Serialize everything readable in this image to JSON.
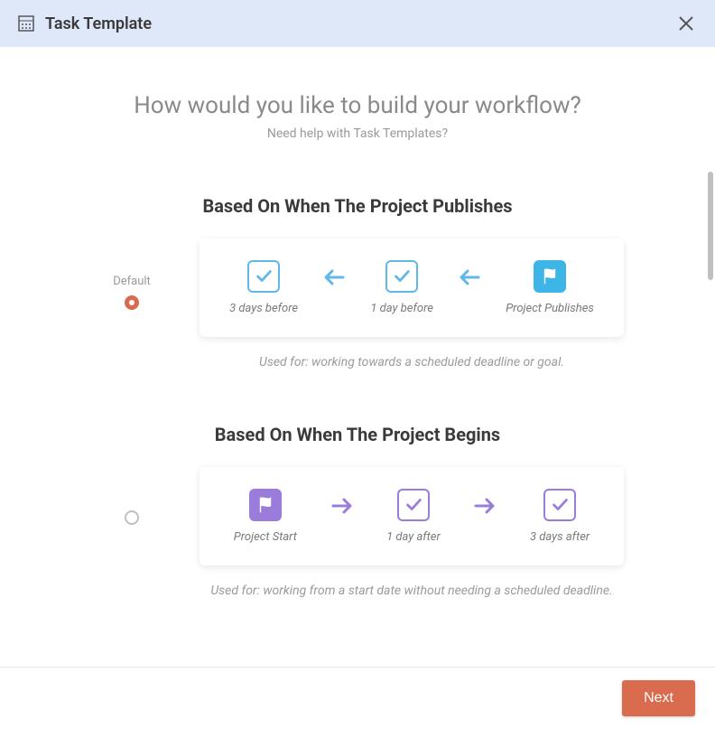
{
  "header": {
    "title": "Task Template"
  },
  "heading": "How would you like to build your workflow?",
  "help_text": "Need help with Task Templates?",
  "options": {
    "publishes": {
      "title": "Based On When The Project Publishes",
      "radio_label": "Default",
      "selected": true,
      "steps": [
        "3 days before",
        "1 day before",
        "Project Publishes"
      ],
      "caption": "Used for: working towards a scheduled deadline or goal."
    },
    "begins": {
      "title": "Based On When The Project Begins",
      "selected": false,
      "steps": [
        "Project Start",
        "1 day after",
        "3 days after"
      ],
      "caption": "Used for: working from a start date without needing a scheduled deadline."
    }
  },
  "footer": {
    "next_label": "Next"
  }
}
